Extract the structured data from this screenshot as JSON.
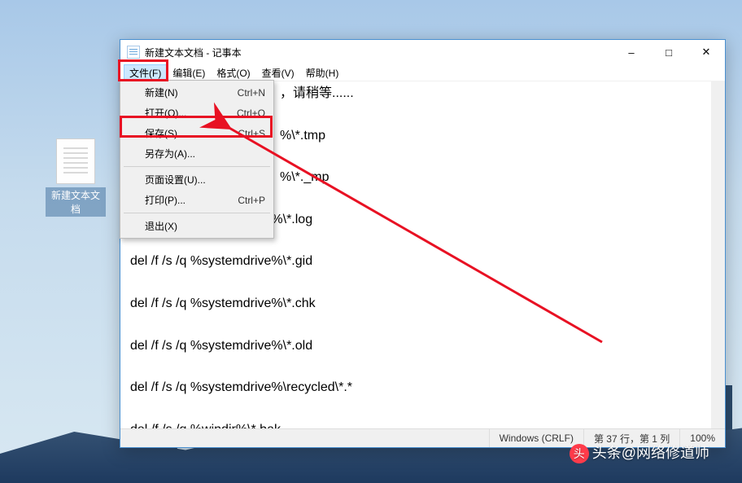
{
  "desktop": {
    "icon_label": "新建文本文档"
  },
  "window": {
    "title": "新建文本文档 - 记事本",
    "menus": [
      "文件(F)",
      "编辑(E)",
      "格式(O)",
      "查看(V)",
      "帮助(H)"
    ],
    "open_menu_index": 0
  },
  "file_menu": {
    "items": [
      {
        "label": "新建(N)",
        "shortcut": "Ctrl+N"
      },
      {
        "label": "打开(O)...",
        "shortcut": "Ctrl+O"
      },
      {
        "label": "保存(S)",
        "shortcut": "Ctrl+S"
      },
      {
        "label": "另存为(A)...",
        "shortcut": ""
      }
    ],
    "items2": [
      {
        "label": "页面设置(U)...",
        "shortcut": ""
      },
      {
        "label": "打印(P)...",
        "shortcut": "Ctrl+P"
      }
    ],
    "items3": [
      {
        "label": "退出(X)",
        "shortcut": ""
      }
    ]
  },
  "editor": {
    "lines": [
      "，请稍等......",
      "",
      "%\\*.tmp",
      "",
      "%\\*._mp",
      "",
      "del /f /s /q %systemdrive%\\*.log",
      "",
      "del /f /s /q %systemdrive%\\*.gid",
      "",
      "del /f /s /q %systemdrive%\\*.chk",
      "",
      "del /f /s /q %systemdrive%\\*.old",
      "",
      "del /f /s /q %systemdrive%\\recycled\\*.*",
      "",
      "del /f /s /q %windir%\\*.bak"
    ]
  },
  "statusbar": {
    "encoding": "Windows (CRLF)",
    "position": "第 37 行，第 1 列",
    "zoom": "100%"
  },
  "watermark": "头条@网络修道师"
}
